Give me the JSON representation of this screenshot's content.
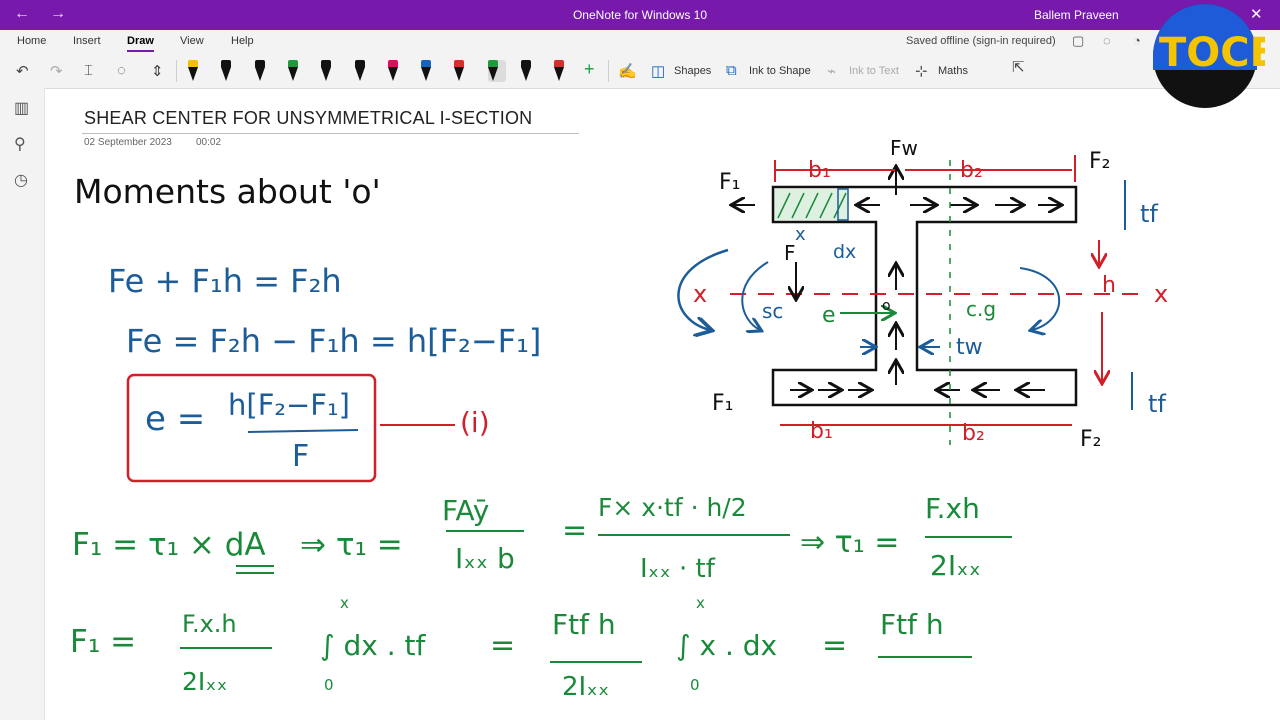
{
  "titlebar": {
    "back": "←",
    "forward": "→",
    "title": "OneNote for Windows 10",
    "user": "Ballem Praveen",
    "close": "✕"
  },
  "menu": {
    "items": [
      "Home",
      "Insert",
      "Draw",
      "View",
      "Help"
    ],
    "active": "Draw",
    "status": "Saved offline (sign-in required)"
  },
  "toolbar": {
    "shapes_label": "Shapes",
    "ink_to_shape_label": "Ink to Shape",
    "ink_to_text_label": "Ink to Text",
    "maths_label": "Maths",
    "pen_colors": [
      "#f2c200",
      "#111111",
      "#111111",
      "#1e9a3c",
      "#111111",
      "#111111",
      "#d4145a",
      "#1565c0",
      "#d32f2f",
      "#1e9a3c",
      "#111111",
      "#d32f2f"
    ],
    "add_pen": "+"
  },
  "page": {
    "title": "SHEAR CENTER FOR UNSYMMETRICAL I-SECTION",
    "date": "02 September 2023",
    "time": "00:02"
  },
  "notes": {
    "heading": "Moments about 'o'",
    "eq1": "Fe + F₁h = F₂h",
    "eq2": "Fe = F₂h − F₁h = h[F₂−F₁]",
    "eq3_lhs": "e =",
    "eq3_num": "h[F₂−F₁]",
    "eq3_den": "F",
    "eq3_tag": "(i)",
    "eq4_a": "F₁ = τ₁ × dA",
    "eq4_b": "⇒ τ₁ =",
    "eq4_b_num": "FAȳ",
    "eq4_b_den": "Iₓₓ b",
    "eq4_c_num": "F× x·tf · h/2",
    "eq4_c_den": "Iₓₓ · tf",
    "eq4_d": "⇒ τ₁ =",
    "eq4_d_num": "F.xh",
    "eq4_d_den": "2Iₓₓ",
    "eq5_a": "F₁ =",
    "eq5_a_num": "F.x.h",
    "eq5_a_den": "2Iₓₓ",
    "eq5_int1": "∫ dx . tf",
    "eq5_b_num": "Ftf h",
    "eq5_b_den": "2Iₓₓ",
    "eq5_int2": "∫ x . dx",
    "eq5_c_num": "Ftf h",
    "int_upper": "x",
    "int_lower": "0"
  },
  "diagram": {
    "F1_top": "F₁",
    "F2_top": "F₂",
    "Fw": "Fw",
    "b1_top": "b₁",
    "b2_top": "b₂",
    "tf_top": "tf",
    "x_label": "x",
    "dx_label": "dx",
    "F_load": "F",
    "sc": "sc",
    "e": "e",
    "o": "o",
    "cg": "c.g",
    "h": "h",
    "tw": "tw",
    "x_left": "x",
    "x_right": "x",
    "F1_bot": "F₁",
    "F2_bot": "F₂",
    "b1_bot": "b₁",
    "b2_bot": "b₂",
    "tf_bot": "tf"
  },
  "colors": {
    "onenote_purple": "#7719aa",
    "ink_black": "#111111",
    "ink_blue": "#1c5d99",
    "ink_green": "#1a8a3a",
    "ink_red": "#d0202a"
  }
}
